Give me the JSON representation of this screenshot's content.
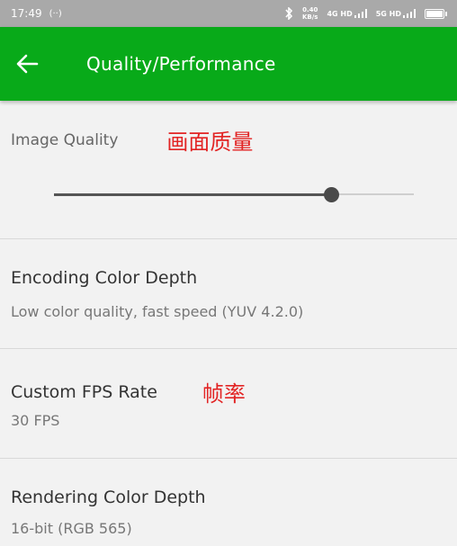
{
  "status_bar": {
    "time": "17:49",
    "net_speed_top": "0.40",
    "net_speed_unit": "KB/s",
    "network1": "4G HD",
    "network2": "5G HD"
  },
  "app_bar": {
    "title": "Quality/Performance",
    "back_icon": "arrow-left-icon",
    "color": "#08aa19"
  },
  "image_quality": {
    "label": "Image Quality",
    "annotation": "画面质量",
    "slider_value": 0.77
  },
  "encoding_color_depth": {
    "title": "Encoding Color Depth",
    "subtitle": "Low color quality, fast speed (YUV 4.2.0)"
  },
  "custom_fps_rate": {
    "title": "Custom FPS Rate",
    "annotation": "帧率",
    "subtitle": "30 FPS"
  },
  "rendering_color_depth": {
    "title": "Rendering Color Depth",
    "subtitle": "16-bit (RGB 565)"
  },
  "colors": {
    "annotation": "#e22424",
    "status_bar": "#a9a9a9",
    "background": "#f2f2f2"
  }
}
